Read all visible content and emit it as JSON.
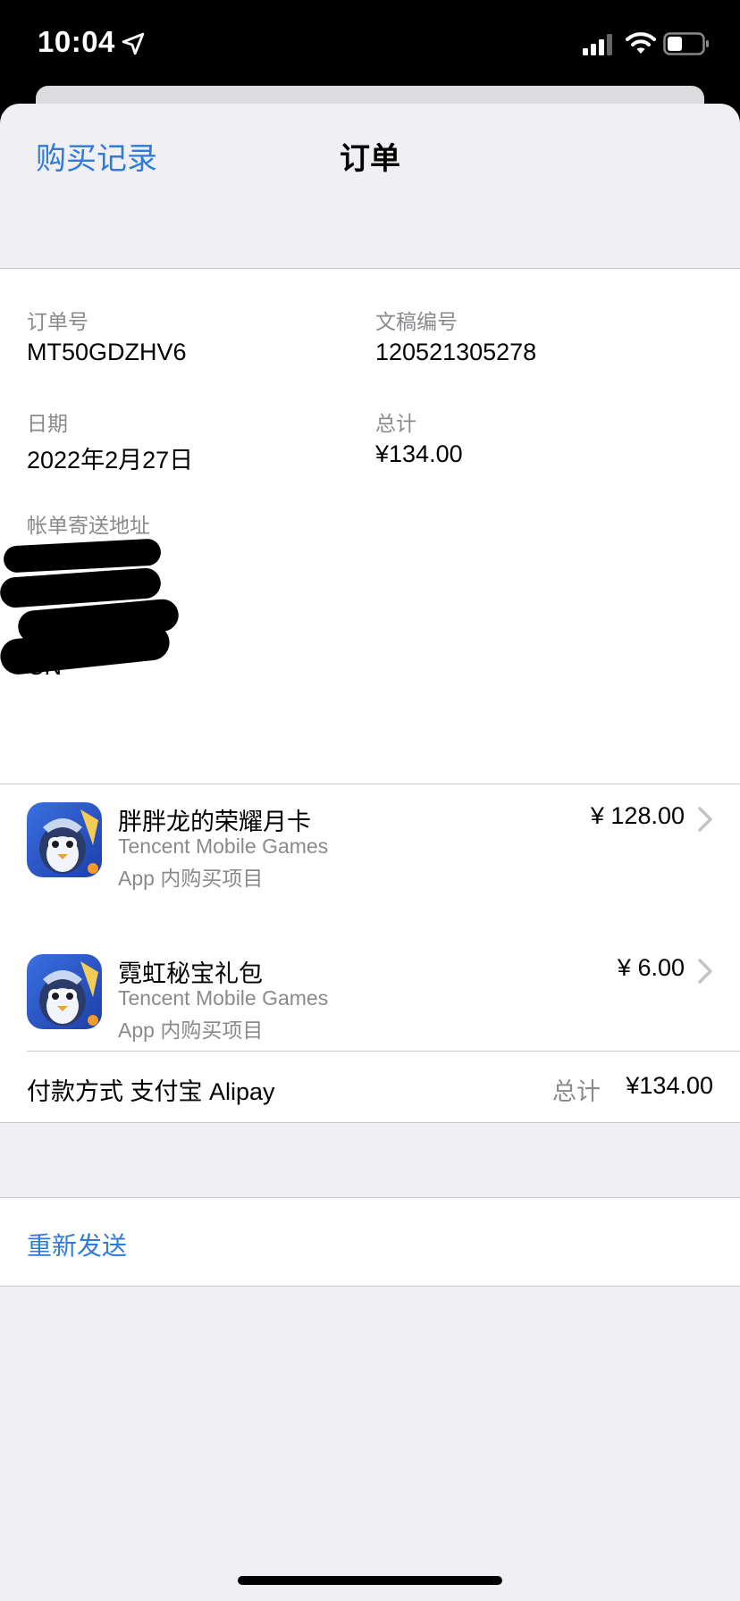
{
  "status_bar": {
    "time": "10:04"
  },
  "nav": {
    "back_label": "购买记录",
    "title": "订单"
  },
  "order": {
    "order_no_label": "订单号",
    "order_no": "MT50GDZHV6",
    "doc_no_label": "文稿编号",
    "doc_no": "120521305278",
    "date_label": "日期",
    "date": "2022年2月27日",
    "total_label": "总计",
    "total": "¥134.00",
    "address_label": "帐单寄送地址",
    "address_country": "CN"
  },
  "items": [
    {
      "title": "胖胖龙的荣耀月卡",
      "developer": "Tencent Mobile Games",
      "type": "App 内购买项目",
      "price": "¥ 128.00"
    },
    {
      "title": "霓虹秘宝礼包",
      "developer": "Tencent Mobile Games",
      "type": "App 内购买项目",
      "price": "¥ 6.00"
    }
  ],
  "payment": {
    "label": "付款方式 支付宝 Alipay",
    "total_label": "总计",
    "total": "¥134.00"
  },
  "actions": {
    "resend": "重新发送"
  },
  "colors": {
    "link": "#2f7bd9",
    "secondary_text": "#8a8a8e",
    "background": "#efeff4"
  }
}
